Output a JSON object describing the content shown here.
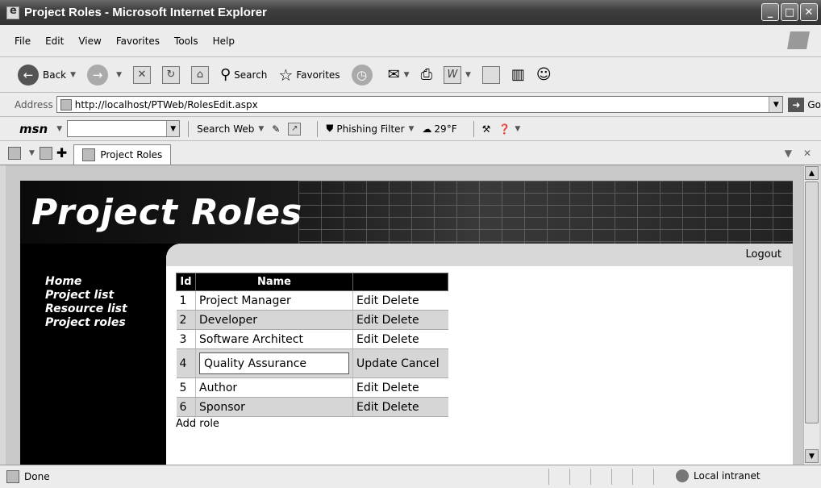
{
  "window": {
    "title": "Project Roles - Microsoft Internet Explorer"
  },
  "menu": [
    "File",
    "Edit",
    "View",
    "Favorites",
    "Tools",
    "Help"
  ],
  "toolbar": {
    "back": "Back",
    "search": "Search",
    "favorites": "Favorites"
  },
  "address": {
    "label": "Address",
    "url": "http://localhost/PTWeb/RolesEdit.aspx",
    "go": "Go"
  },
  "msn": {
    "logo": "msn",
    "search_web": "Search Web",
    "phishing": "Phishing Filter",
    "weather": "29°F"
  },
  "tab": {
    "label": "Project Roles"
  },
  "page": {
    "title": "Project Roles",
    "logout": "Logout",
    "nav": [
      "Home",
      "Project list",
      "Resource list",
      "Project roles"
    ],
    "table_headers": {
      "id": "Id",
      "name": "Name"
    },
    "rows": [
      {
        "id": "1",
        "name": "Project Manager",
        "action1": "Edit",
        "action2": "Delete"
      },
      {
        "id": "2",
        "name": "Developer",
        "action1": "Edit",
        "action2": "Delete"
      },
      {
        "id": "3",
        "name": "Software Architect",
        "action1": "Edit",
        "action2": "Delete"
      },
      {
        "id": "4",
        "name": "Quality Assurance",
        "action1": "Update",
        "action2": "Cancel"
      },
      {
        "id": "5",
        "name": "Author",
        "action1": "Edit",
        "action2": "Delete"
      },
      {
        "id": "6",
        "name": "Sponsor",
        "action1": "Edit",
        "action2": "Delete"
      }
    ],
    "add_role": "Add role"
  },
  "status": {
    "text": "Done",
    "zone": "Local intranet"
  }
}
